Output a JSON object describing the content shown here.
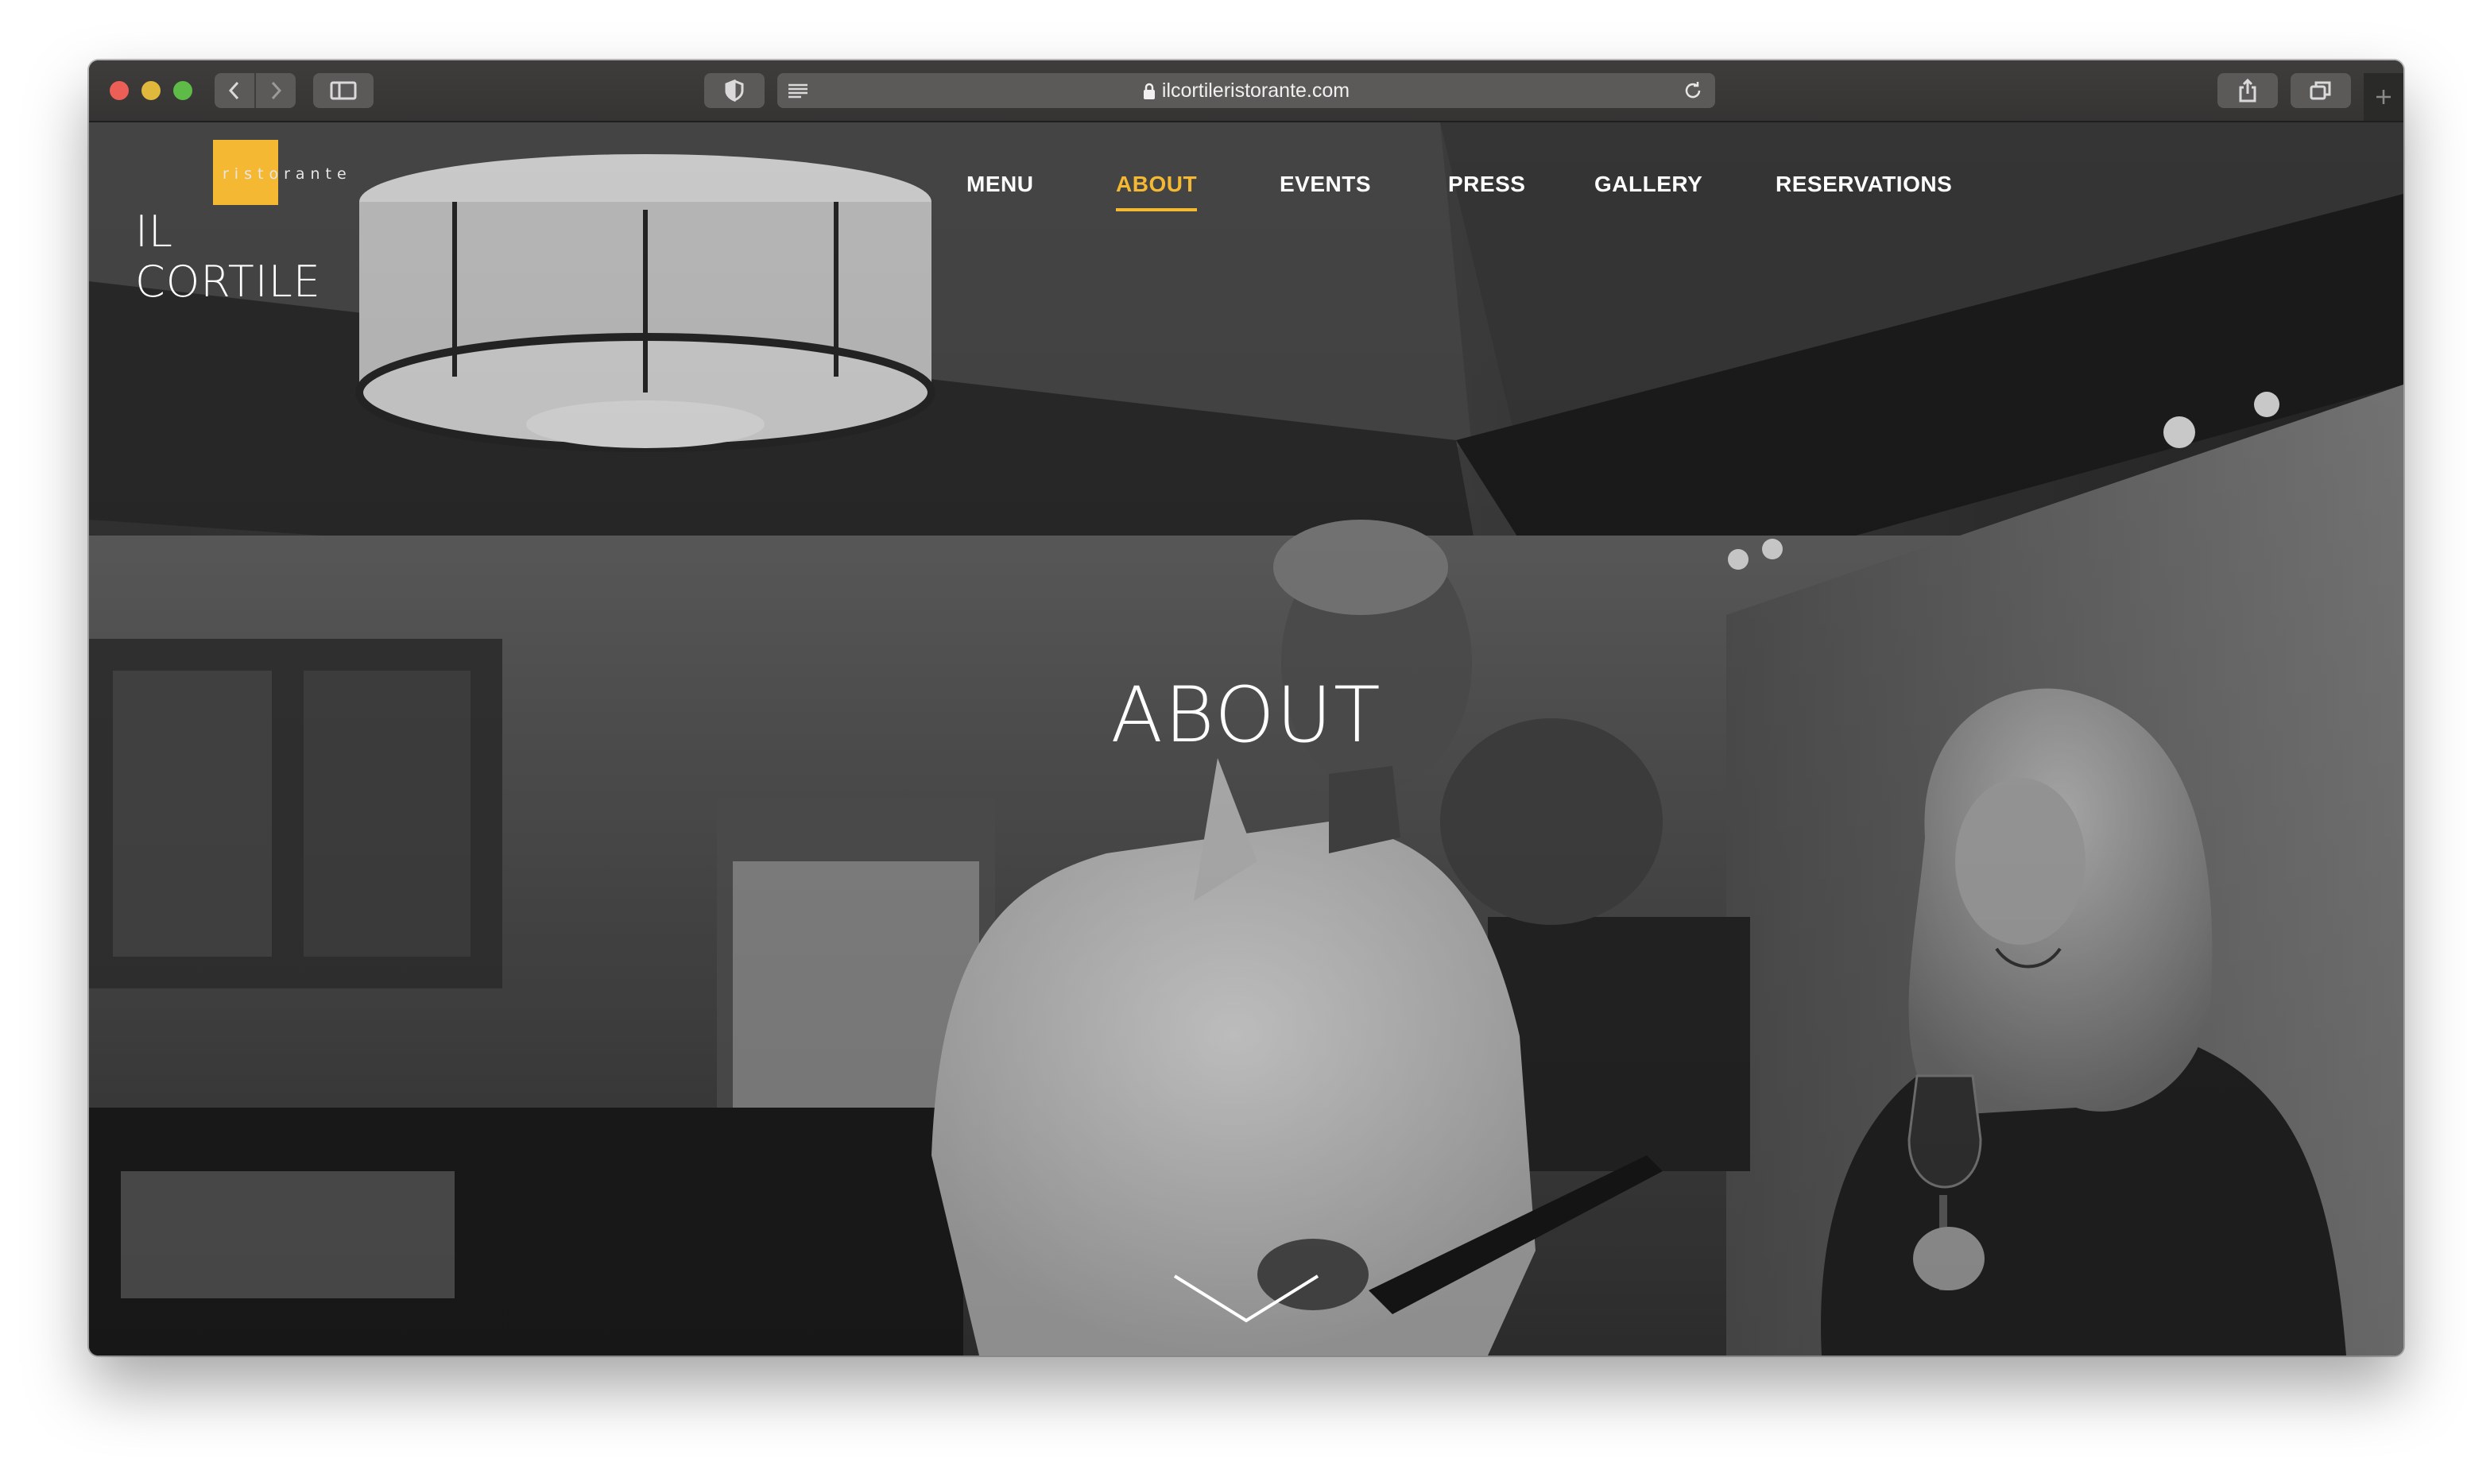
{
  "browser": {
    "url": "ilcortileristorante.com",
    "icons": {
      "back": "chevron-left-icon",
      "forward": "chevron-right-icon",
      "sidebar": "sidebar-icon",
      "privacy": "shield-icon",
      "reader": "reader-icon",
      "lock": "lock-icon",
      "reload": "reload-icon",
      "share": "share-icon",
      "tabs": "tabs-icon",
      "new_tab": "plus-icon"
    }
  },
  "site": {
    "logo": {
      "tagline": "ristorante",
      "name": "IL CORTILE",
      "accent_color": "#f5b833"
    },
    "nav": [
      {
        "label": "MENU",
        "active": false
      },
      {
        "label": "ABOUT",
        "active": true
      },
      {
        "label": "EVENTS",
        "active": false
      },
      {
        "label": "PRESS",
        "active": false
      },
      {
        "label": "GALLERY",
        "active": false
      },
      {
        "label": "RESERVATIONS",
        "active": false
      }
    ],
    "hero": {
      "title": "ABOUT",
      "scroll_icon": "chevron-down-icon"
    }
  }
}
